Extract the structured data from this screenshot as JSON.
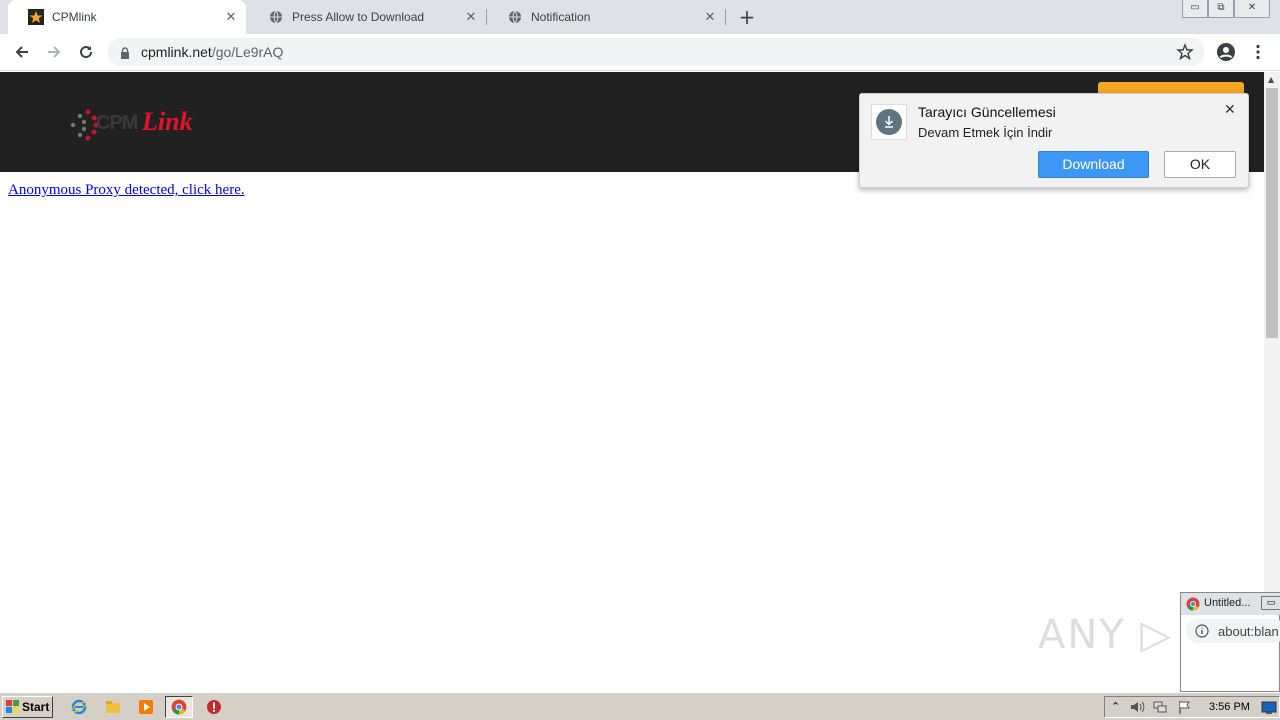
{
  "tabs": [
    {
      "label": "CPMlink",
      "active": true
    },
    {
      "label": "Press Allow to Download",
      "active": false
    },
    {
      "label": "Notification",
      "active": false
    }
  ],
  "window_controls": {
    "minimize": "▭",
    "restore": "⧉",
    "close": "✕"
  },
  "toolbar": {
    "url_host": "cpmlink.net",
    "url_path": "/go/Le9rAQ"
  },
  "site": {
    "logo_cpm": "CPM",
    "logo_link": "Link",
    "proxy_link": "Anonymous Proxy detected, click here."
  },
  "notification": {
    "title": "Tarayıcı Güncellemesi",
    "message": "Devam Etmek İçin İndir",
    "download_label": "Download",
    "ok_label": "OK",
    "close_glyph": "✕"
  },
  "mini_window": {
    "tab_label": "Untitled...",
    "url": "about:blan"
  },
  "watermark": "ANY ▷ RUN",
  "taskbar": {
    "start_label": "Start",
    "clock": "3:56 PM"
  },
  "colors": {
    "brand_red": "#e3122b",
    "header_bg": "#212121",
    "download_blue": "#3d97f5",
    "orange": "#f5a623"
  }
}
